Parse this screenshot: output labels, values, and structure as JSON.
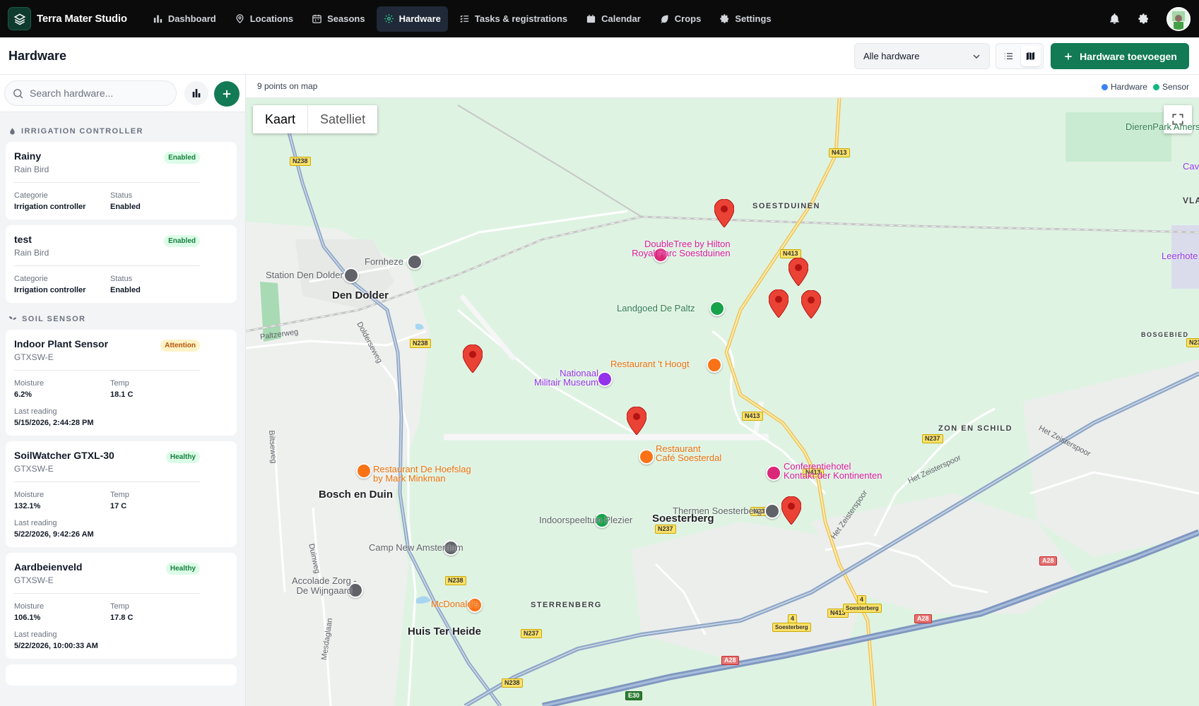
{
  "app": {
    "name": "Terra Mater Studio",
    "nav": [
      {
        "label": "Dashboard",
        "icon": "bar-chart-icon"
      },
      {
        "label": "Locations",
        "icon": "map-pin-icon"
      },
      {
        "label": "Seasons",
        "icon": "calendar-grid-icon"
      },
      {
        "label": "Hardware",
        "icon": "cpu-icon",
        "active": true
      },
      {
        "label": "Tasks & registrations",
        "icon": "list-check-icon"
      },
      {
        "label": "Calendar",
        "icon": "calendar-icon"
      },
      {
        "label": "Crops",
        "icon": "leaf-icon"
      },
      {
        "label": "Settings",
        "icon": "gear-icon"
      }
    ]
  },
  "header": {
    "title": "Hardware",
    "filter_selected": "Alle hardware",
    "add_label": "Hardware toevoegen"
  },
  "sidebar": {
    "search_placeholder": "Search hardware...",
    "groups": [
      {
        "title": "IRRIGATION CONTROLLER",
        "icon": "droplet-icon",
        "items": [
          {
            "name": "Rainy",
            "sub": "Rain Bird",
            "badge": "Enabled",
            "k1": "Categorie",
            "v1": "Irrigation controller",
            "k2": "Status",
            "v2": "Enabled"
          },
          {
            "name": "test",
            "sub": "Rain Bird",
            "badge": "Enabled",
            "k1": "Categorie",
            "v1": "Irrigation controller",
            "k2": "Status",
            "v2": "Enabled"
          }
        ]
      },
      {
        "title": "SOIL SENSOR",
        "icon": "sprout-icon",
        "items": [
          {
            "name": "Indoor Plant Sensor",
            "sub": "GTXSW-E",
            "badge": "Attention",
            "k1": "Moisture",
            "v1": "6.2%",
            "k2": "Temp",
            "v2": "18.1 C",
            "lr_label": "Last reading",
            "lr_value": "5/15/2026, 2:44:28 PM"
          },
          {
            "name": "SoilWatcher GTXL-30",
            "sub": "GTXSW-E",
            "badge": "Healthy",
            "k1": "Moisture",
            "v1": "132.1%",
            "k2": "Temp",
            "v2": "17 C",
            "lr_label": "Last reading",
            "lr_value": "5/22/2026, 9:42:26 AM"
          },
          {
            "name": "Aardbeienveld",
            "sub": "GTXSW-E",
            "badge": "Healthy",
            "k1": "Moisture",
            "v1": "106.1%",
            "k2": "Temp",
            "v2": "17.8 C",
            "lr_label": "Last reading",
            "lr_value": "5/22/2026, 10:00:33 AM"
          }
        ]
      }
    ]
  },
  "map": {
    "points_text": "9 points on map",
    "legend": [
      {
        "label": "Hardware",
        "color": "#3b82f6"
      },
      {
        "label": "Sensor",
        "color": "#10b981"
      }
    ],
    "map_types": [
      "Kaart",
      "Satelliet"
    ],
    "towns": [
      "Den Dolder",
      "Bosch en Duin",
      "Soesterberg",
      "Huis Ter Heide"
    ],
    "areas": [
      "SOESTDUINEN",
      "ZON EN SCHILD",
      "STERRENBERG",
      "BOSGEBIED",
      "VLA"
    ],
    "pois": {
      "fornheze": "Fornheze",
      "station": "Station Den Dolder",
      "doubletree1": "DoubleTree by Hilton",
      "doubletree2": "Royal Parc Soestduinen",
      "paltz": "Landgoed De Paltz",
      "hoogt": "Restaurant 't Hoogt",
      "museum1": "Nationaal",
      "museum2": "Militair Museum",
      "soesterdal1": "Restaurant",
      "soesterdal2": "Café Soesterdal",
      "hoefslag1": "Restaurant De Hoefslag",
      "hoefslag2": "by Mark Minkman",
      "conf1": "Conferentiehotel",
      "conf2": "Kontakt der Kontinenten",
      "thermen": "Thermen Soesterberg",
      "speeltuin": "Indoorspeeltuin Plezier",
      "camp": "Camp New Amsterdam",
      "accolade1": "Accolade Zorg -",
      "accolade2": "De Wijngaard",
      "mcd": "McDonald's",
      "dierenpark": "DierenPark Amersf",
      "cav": "Cav",
      "leerhotel": "Leerhote"
    },
    "streets": [
      "Paltzerweg",
      "Dolderseweg",
      "Biltseweg",
      "Het Zeisterspoor",
      "Het Zeisterspoor",
      "Het Zeisterspoor",
      "Duinweg",
      "Mesdaglaan"
    ],
    "roads": [
      "N238",
      "N238",
      "N238",
      "N238",
      "N413",
      "N413",
      "N413",
      "N413",
      "N413",
      "N237",
      "N237",
      "N237",
      "N237",
      "A28",
      "A28",
      "A28",
      "E30",
      "Soesterberg",
      "Soesterberg",
      "4",
      "4",
      "N23"
    ]
  }
}
